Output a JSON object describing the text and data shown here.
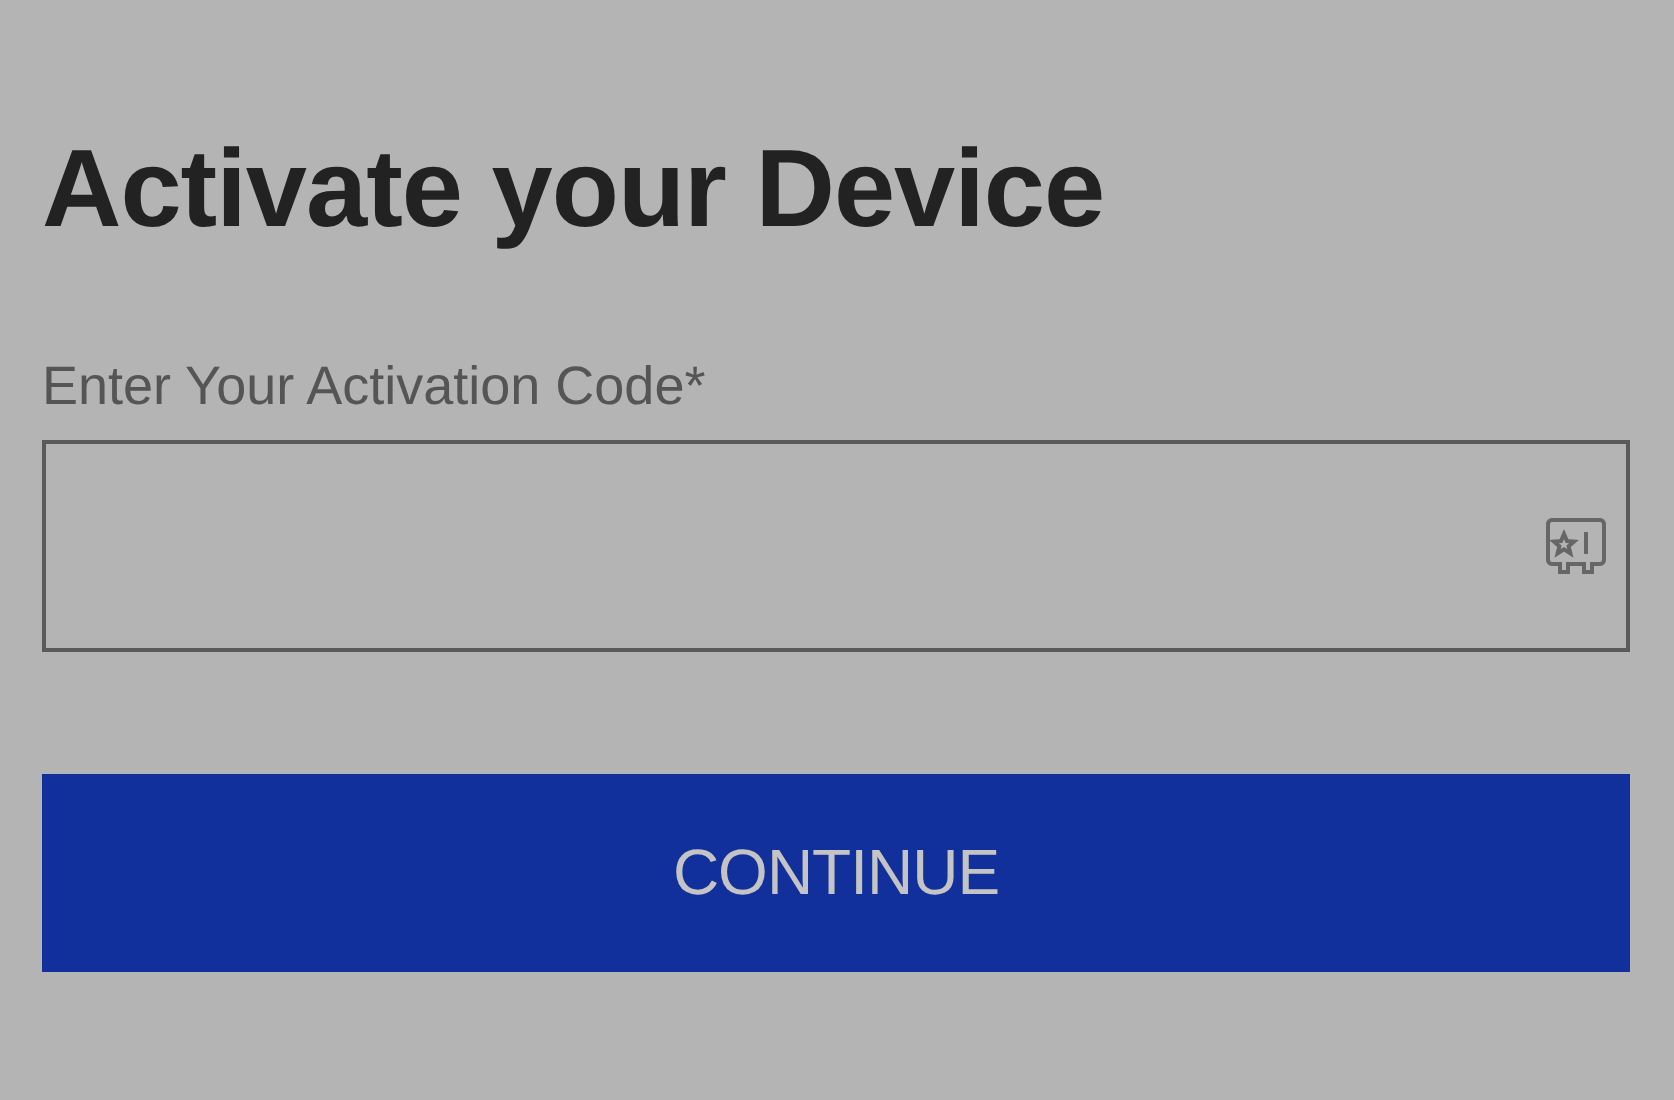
{
  "heading": "Activate your Device",
  "field": {
    "label": "Enter Your Activation Code*"
  },
  "button": {
    "label": "CONTINUE"
  }
}
